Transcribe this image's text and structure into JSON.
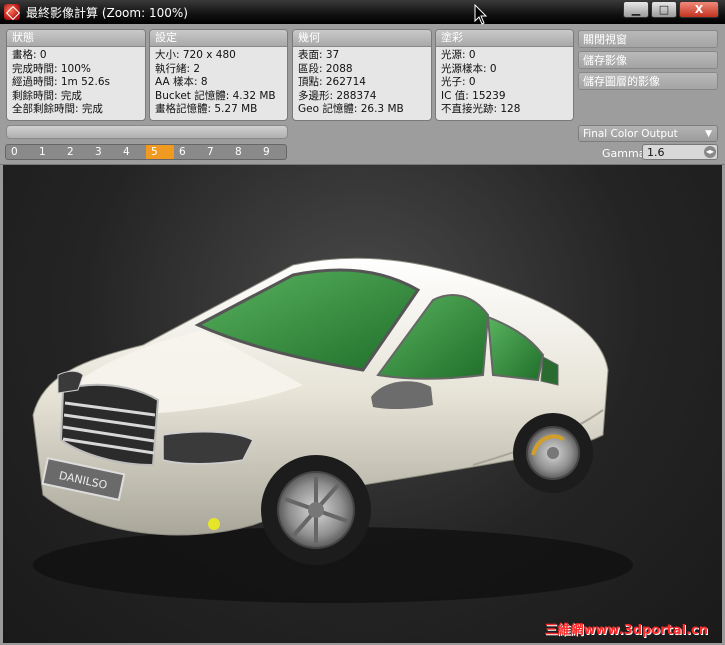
{
  "window": {
    "title": "最終影像計算 (Zoom: 100%)",
    "controls": {
      "minimize": "▁",
      "maximize": "□",
      "close": "X"
    }
  },
  "panels": {
    "status": {
      "header": "狀態",
      "rows": [
        "畫格: 0",
        "完成時間: 100%",
        "經過時間: 1m 52.6s",
        "剩餘時間: 完成",
        "全部剩餘時間: 完成"
      ]
    },
    "settings": {
      "header": "設定",
      "rows": [
        "大小: 720 x 480",
        "執行緒: 2",
        "AA 樣本: 8",
        "Bucket 記憶體: 4.32 MB",
        "畫格記憶體: 5.27 MB"
      ]
    },
    "geometry": {
      "header": "幾何",
      "rows": [
        "表面: 37",
        "區段: 2088",
        "頂點: 262714",
        "多邊形: 288374",
        "Geo 記憶體: 26.3 MB"
      ]
    },
    "shading": {
      "header": "塗彩",
      "rows": [
        "光源: 0",
        "光源樣本: 0",
        "光子: 0",
        "IC 值: 15239",
        "不直接光跡: 128"
      ]
    }
  },
  "side_buttons": {
    "close_window": "關閉視窗",
    "save_image": "儲存影像",
    "save_layered": "儲存圖層的影像"
  },
  "frame_bar": {
    "frames": [
      "0",
      "1",
      "2",
      "3",
      "4",
      "5",
      "6",
      "7",
      "8",
      "9"
    ],
    "active_index": 5
  },
  "output": {
    "selected": "Final Color Output",
    "caret": "▼"
  },
  "gamma": {
    "label": "Gamma",
    "value": "1.6",
    "spin": "◂▸"
  },
  "render": {
    "plate_text": "DANILSO",
    "watermark": "三維網www.3dportal.cn"
  },
  "colors": {
    "accent": "#f19a22",
    "car_body": "#e9e7dc",
    "glass": "#2f8f3a"
  },
  "icons": {
    "app": "render-app-icon",
    "cursor": "mouse-cursor-icon"
  }
}
